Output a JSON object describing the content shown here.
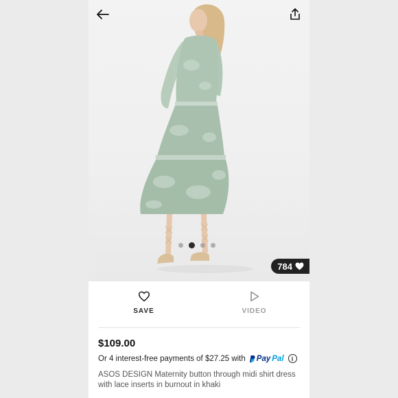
{
  "header": {
    "back_icon": "arrow-left-icon",
    "share_icon": "share-upload-icon"
  },
  "gallery": {
    "image_count": 4,
    "active_index": 1,
    "likes_count": "784"
  },
  "actions": {
    "save_label": "SAVE",
    "video_label": "VIDEO"
  },
  "product": {
    "price": "$109.00",
    "installments_text": "Or 4 interest-free payments of $27.25 with",
    "paypal_pay": "Pay",
    "paypal_pal": "Pal",
    "description": "ASOS DESIGN Maternity button through midi shirt dress with lace inserts in burnout in khaki"
  },
  "colors": {
    "dress": "#a9c3b0",
    "paypal_dark": "#003087",
    "paypal_light": "#009cde",
    "badge": "#222222"
  }
}
